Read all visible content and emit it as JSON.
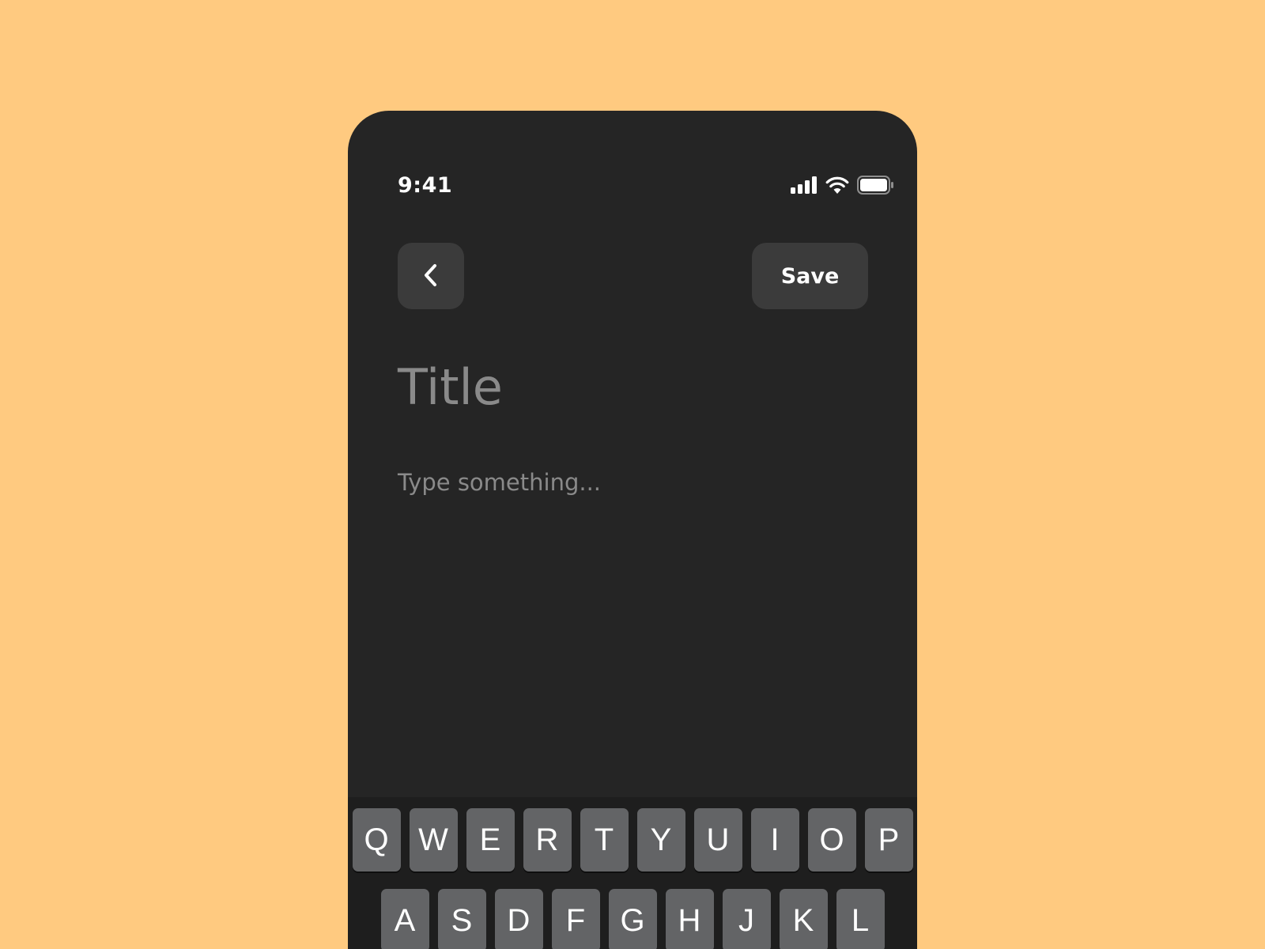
{
  "status_bar": {
    "time": "9:41",
    "icons": [
      "cellular-signal-icon",
      "wifi-icon",
      "battery-icon"
    ]
  },
  "header": {
    "back_icon": "chevron-left-icon",
    "save_label": "Save"
  },
  "editor": {
    "title_placeholder": "Title",
    "body_placeholder": "Type something..."
  },
  "keyboard": {
    "row1": [
      "Q",
      "W",
      "E",
      "R",
      "T",
      "Y",
      "U",
      "I",
      "O",
      "P"
    ],
    "row2": [
      "A",
      "S",
      "D",
      "F",
      "G",
      "H",
      "J",
      "K",
      "L"
    ]
  },
  "colors": {
    "background": "#FFCA80",
    "screen": "#252525",
    "button": "#3B3B3B",
    "placeholder": "#8A8A8A",
    "key": "#636466",
    "text": "#FFFFFF"
  }
}
